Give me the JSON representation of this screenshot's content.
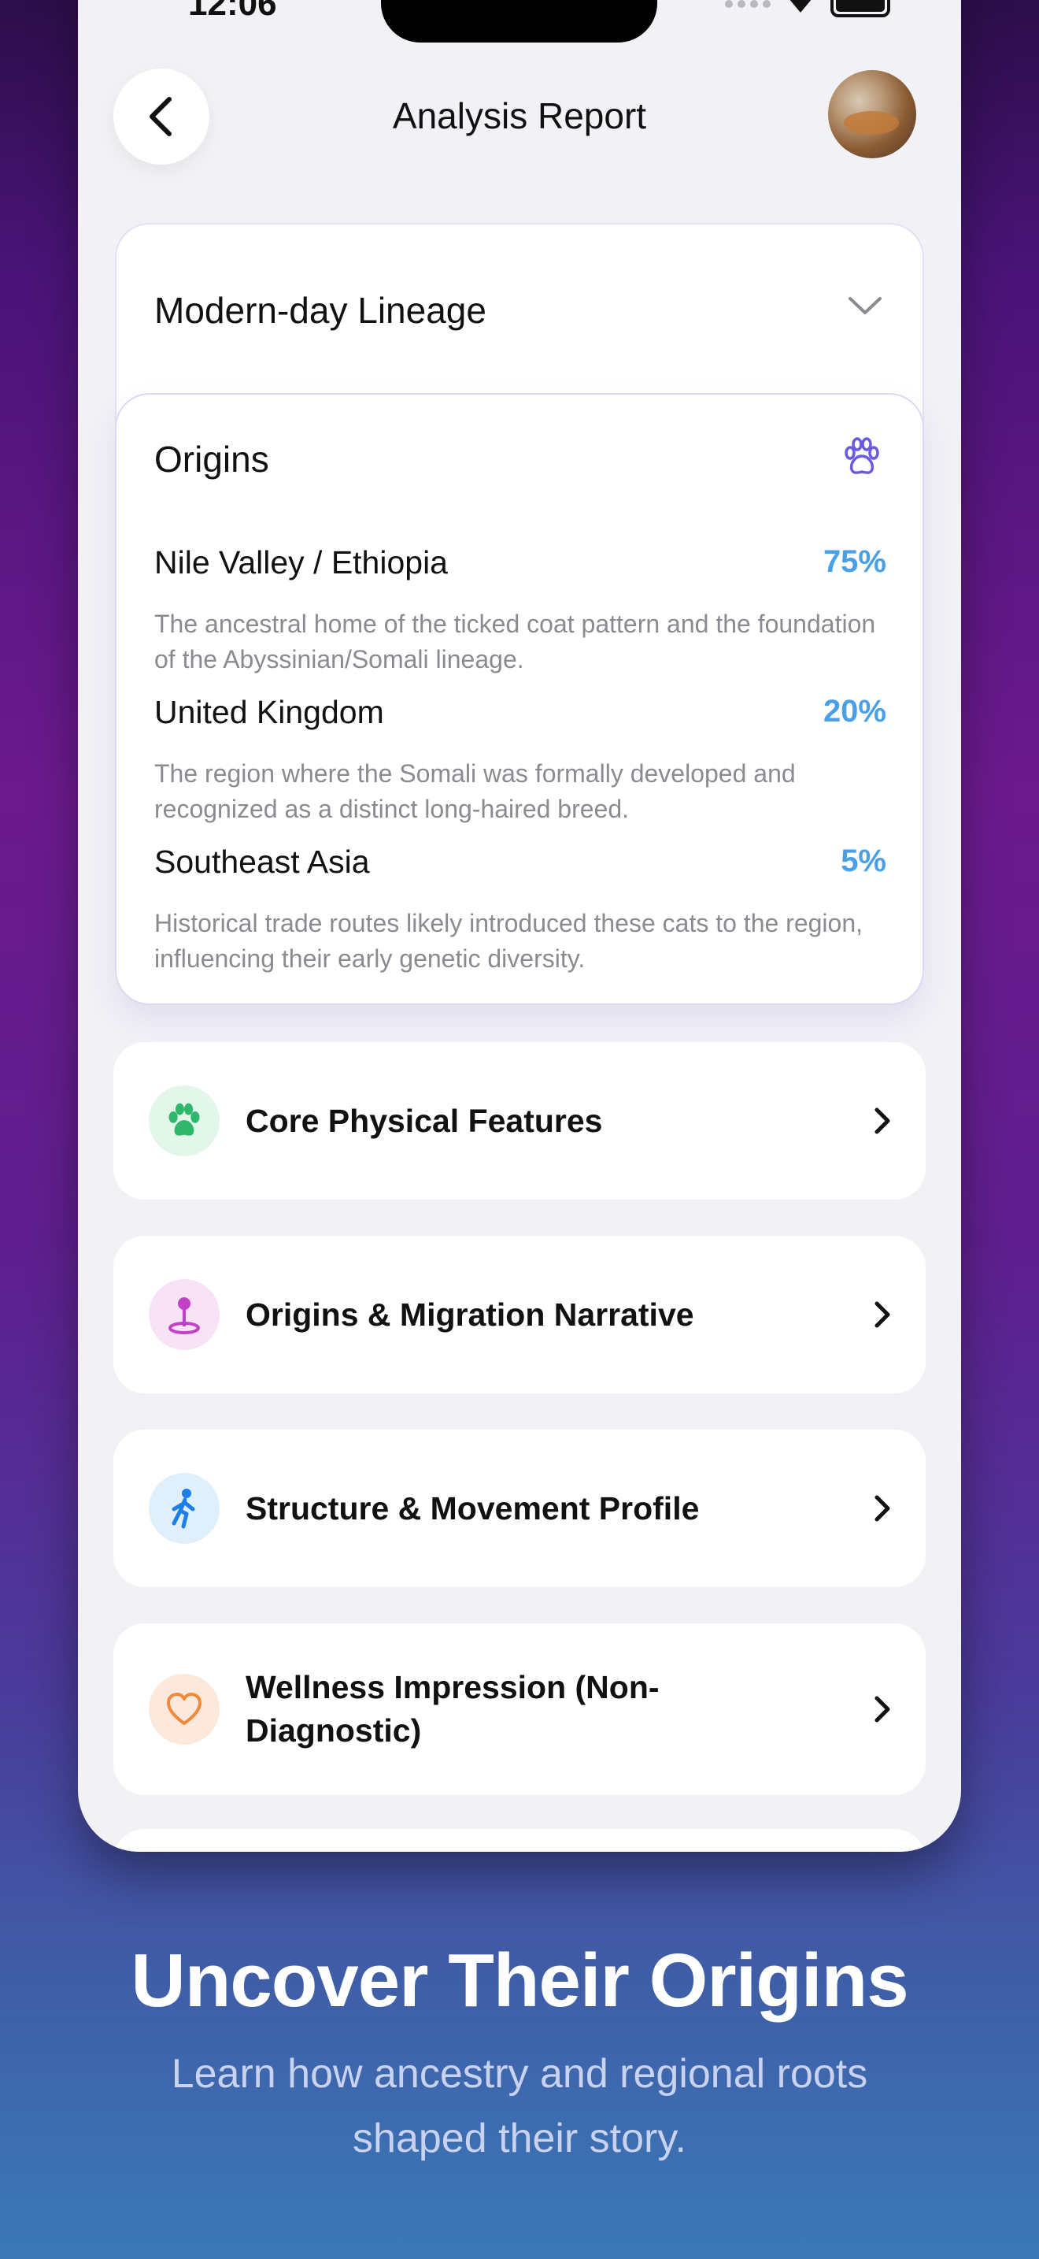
{
  "status": {
    "time": "12:06"
  },
  "header": {
    "title": "Analysis Report"
  },
  "lineage": {
    "title": "Modern-day Lineage"
  },
  "origins": {
    "title": "Origins",
    "regions": [
      {
        "name": "Nile Valley / Ethiopia",
        "percent": "75%",
        "description": "The ancestral home of the ticked coat pattern and the foundation of the Abyssinian/Somali lineage."
      },
      {
        "name": "United Kingdom",
        "percent": "20%",
        "description": "The region where the Somali was formally developed and recognized as a distinct long-haired breed."
      },
      {
        "name": "Southeast Asia",
        "percent": "5%",
        "description": "Historical trade routes likely introduced these cats to the region, influencing their early genetic diversity."
      }
    ]
  },
  "sections": [
    {
      "label": "Core Physical Features",
      "icon": "paw-icon",
      "color": "#2fb86b"
    },
    {
      "label": "Origins & Migration Narrative",
      "icon": "location-pin-icon",
      "color": "#c341c8"
    },
    {
      "label": "Structure & Movement Profile",
      "icon": "walking-person-icon",
      "color": "#1e7fe6"
    },
    {
      "label": "Wellness Impression (Non-Diagnostic)",
      "icon": "heart-icon",
      "color": "#f08a3a"
    }
  ],
  "promo": {
    "title": "Uncover Their Origins",
    "subtitle": "Learn how ancestry and regional roots shaped their story."
  }
}
